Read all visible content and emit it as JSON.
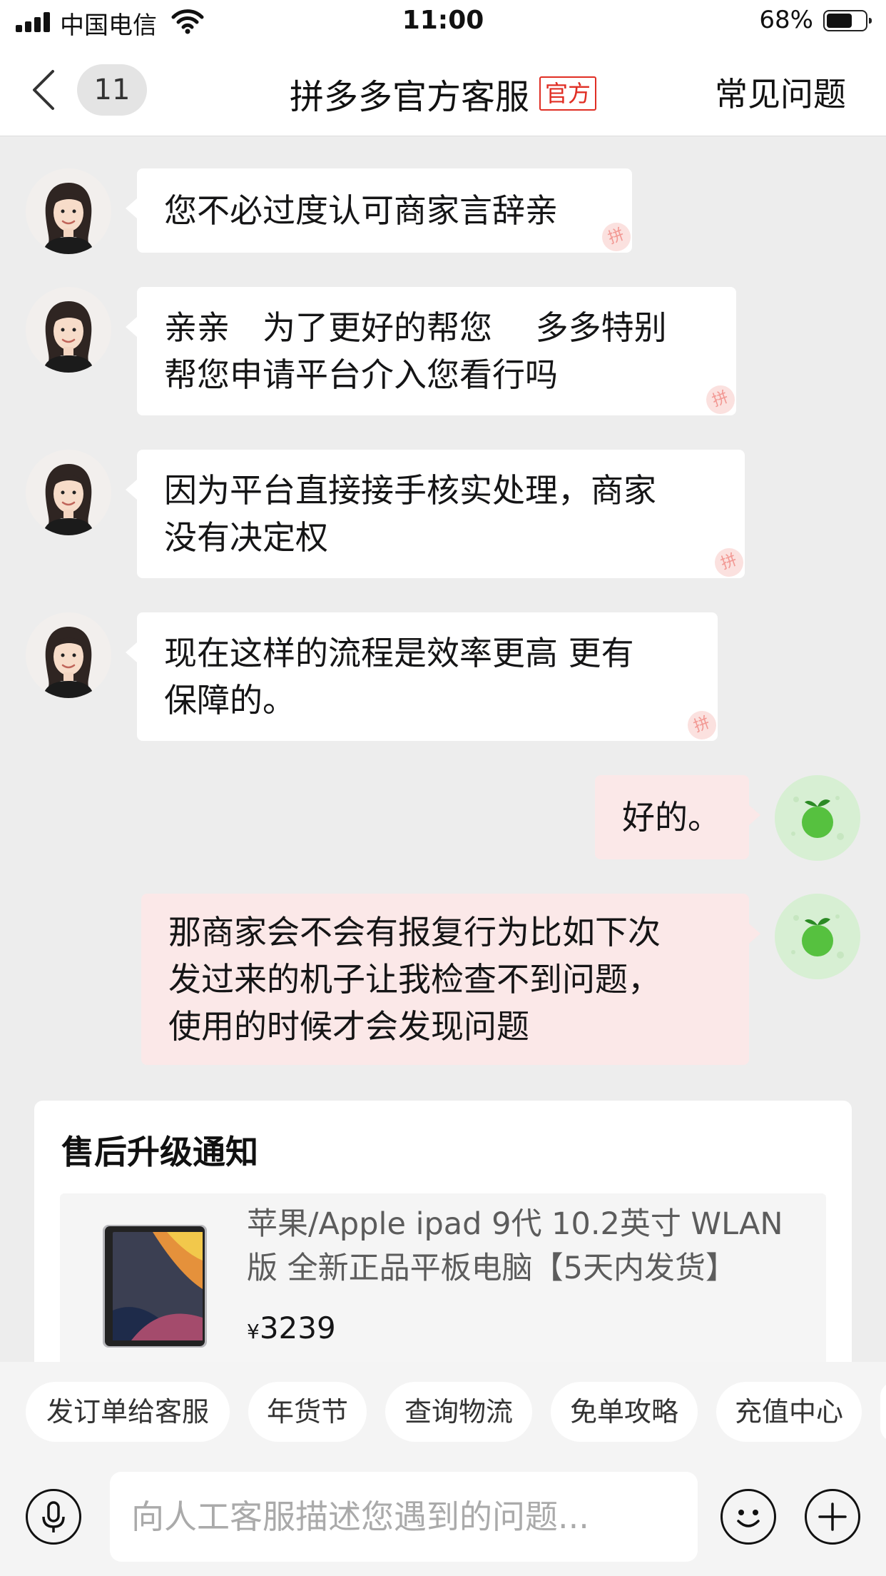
{
  "status_bar": {
    "carrier": "中国电信",
    "time": "11:00",
    "battery": "68%",
    "battery_level": 0.68,
    "icons": [
      "signal-icon",
      "wifi-icon",
      "battery-icon"
    ]
  },
  "nav": {
    "unread_count": "11",
    "title": "拼多多官方客服",
    "badge": "官方",
    "faq_label": "常见问题",
    "icons": [
      "back-arrow-icon"
    ]
  },
  "messages": [
    {
      "from": "service",
      "lines": [
        "您不必过度认可商家言辞亲"
      ]
    },
    {
      "from": "service",
      "lines": [
        "亲亲　为了更好的帮您　 多多特别",
        "帮您申请平台介入您看行吗"
      ]
    },
    {
      "from": "service",
      "lines": [
        "因为平台直接接手核实处理，商家",
        "没有决定权"
      ]
    },
    {
      "from": "service",
      "lines": [
        "现在这样的流程是效率更高 更有",
        "保障的。"
      ]
    },
    {
      "from": "user",
      "lines": [
        "好的。"
      ]
    },
    {
      "from": "user",
      "lines": [
        "那商家会不会有报复行为比如下次",
        "发过来的机子让我检查不到问题，",
        "使用的时候才会发现问题"
      ]
    }
  ],
  "watermark": "拼",
  "notice": {
    "title": "售后升级通知",
    "product": {
      "name_lines": [
        "苹果/Apple ipad 9代 10.2英寸 WLAN",
        "版 全新正品平板电脑【5天内发货】"
      ],
      "currency": "¥",
      "price": "3239"
    }
  },
  "quick_replies": [
    "发订单给客服",
    "年货节",
    "查询物流",
    "免单攻略",
    "充值中心"
  ],
  "input": {
    "placeholder": "向人工客服描述您遇到的问题...",
    "icons": [
      "microphone-icon",
      "emoji-icon",
      "plus-icon"
    ]
  },
  "colors": {
    "brand_red": "#e02e24",
    "incoming_bubble": "#ffffff",
    "outgoing_bubble": "#fbe8e8",
    "background": "#ededed"
  }
}
